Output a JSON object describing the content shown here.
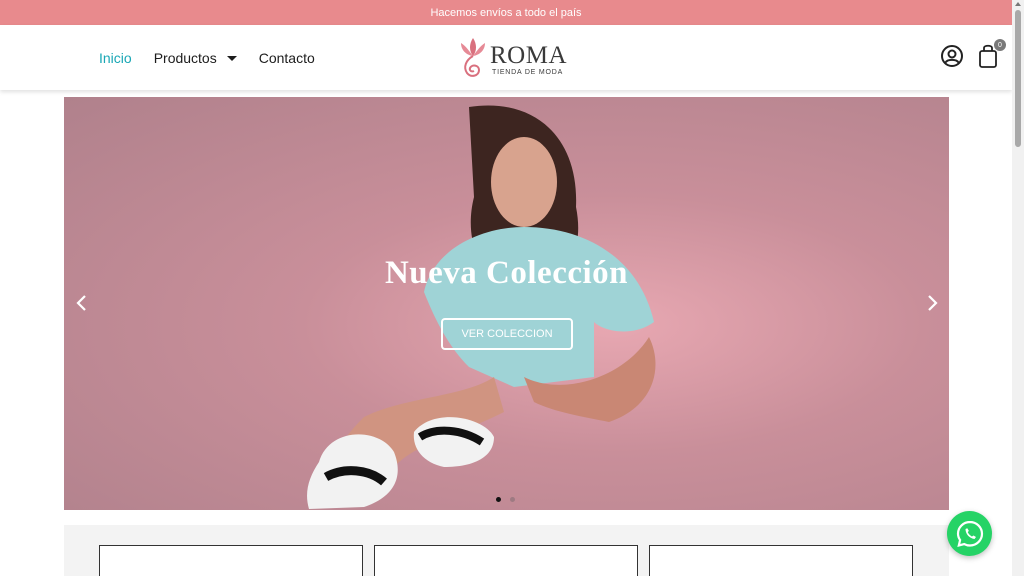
{
  "topbar": {
    "text": "Hacemos envíos a todo el país"
  },
  "nav": {
    "items": [
      {
        "label": "Inicio",
        "active": true
      },
      {
        "label": "Productos",
        "dropdown": true
      },
      {
        "label": "Contacto"
      }
    ]
  },
  "logo": {
    "name": "ROMA",
    "tagline": "TIENDA DE MODA"
  },
  "header_icons": {
    "account": "user-circle-icon",
    "cart": "shopping-bag-icon",
    "cart_count": "0"
  },
  "hero": {
    "title": "Nueva Colección",
    "button_label": "VER COLECCION",
    "slide_count": 2,
    "active_slide": 1
  },
  "colors": {
    "topbar": "#e88a8d",
    "accent": "#1aa7b5",
    "whatsapp": "#25d366"
  },
  "whatsapp": {
    "icon": "whatsapp-icon"
  }
}
